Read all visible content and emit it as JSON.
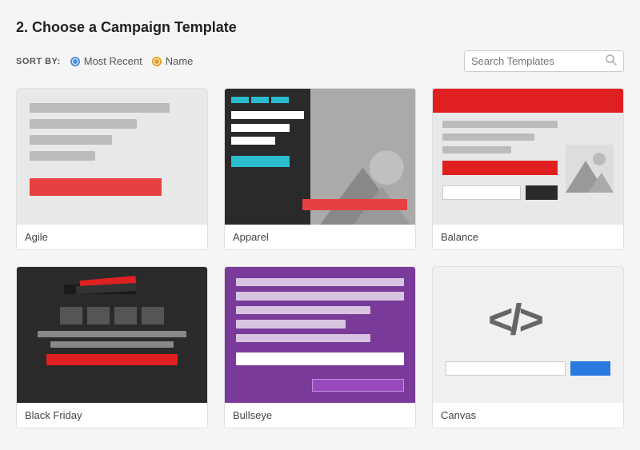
{
  "page": {
    "title": "2. Choose a Campaign Template"
  },
  "sort_bar": {
    "label": "SORT BY:",
    "option_recent": "Most Recent",
    "option_name": "Name",
    "search_placeholder": "Search Templates"
  },
  "templates": [
    {
      "id": "agile",
      "name": "Agile"
    },
    {
      "id": "apparel",
      "name": "Apparel"
    },
    {
      "id": "balance",
      "name": "Balance"
    },
    {
      "id": "blackfriday",
      "name": "Black Friday"
    },
    {
      "id": "bullseye",
      "name": "Bullseye"
    },
    {
      "id": "canvas",
      "name": "Canvas"
    }
  ]
}
